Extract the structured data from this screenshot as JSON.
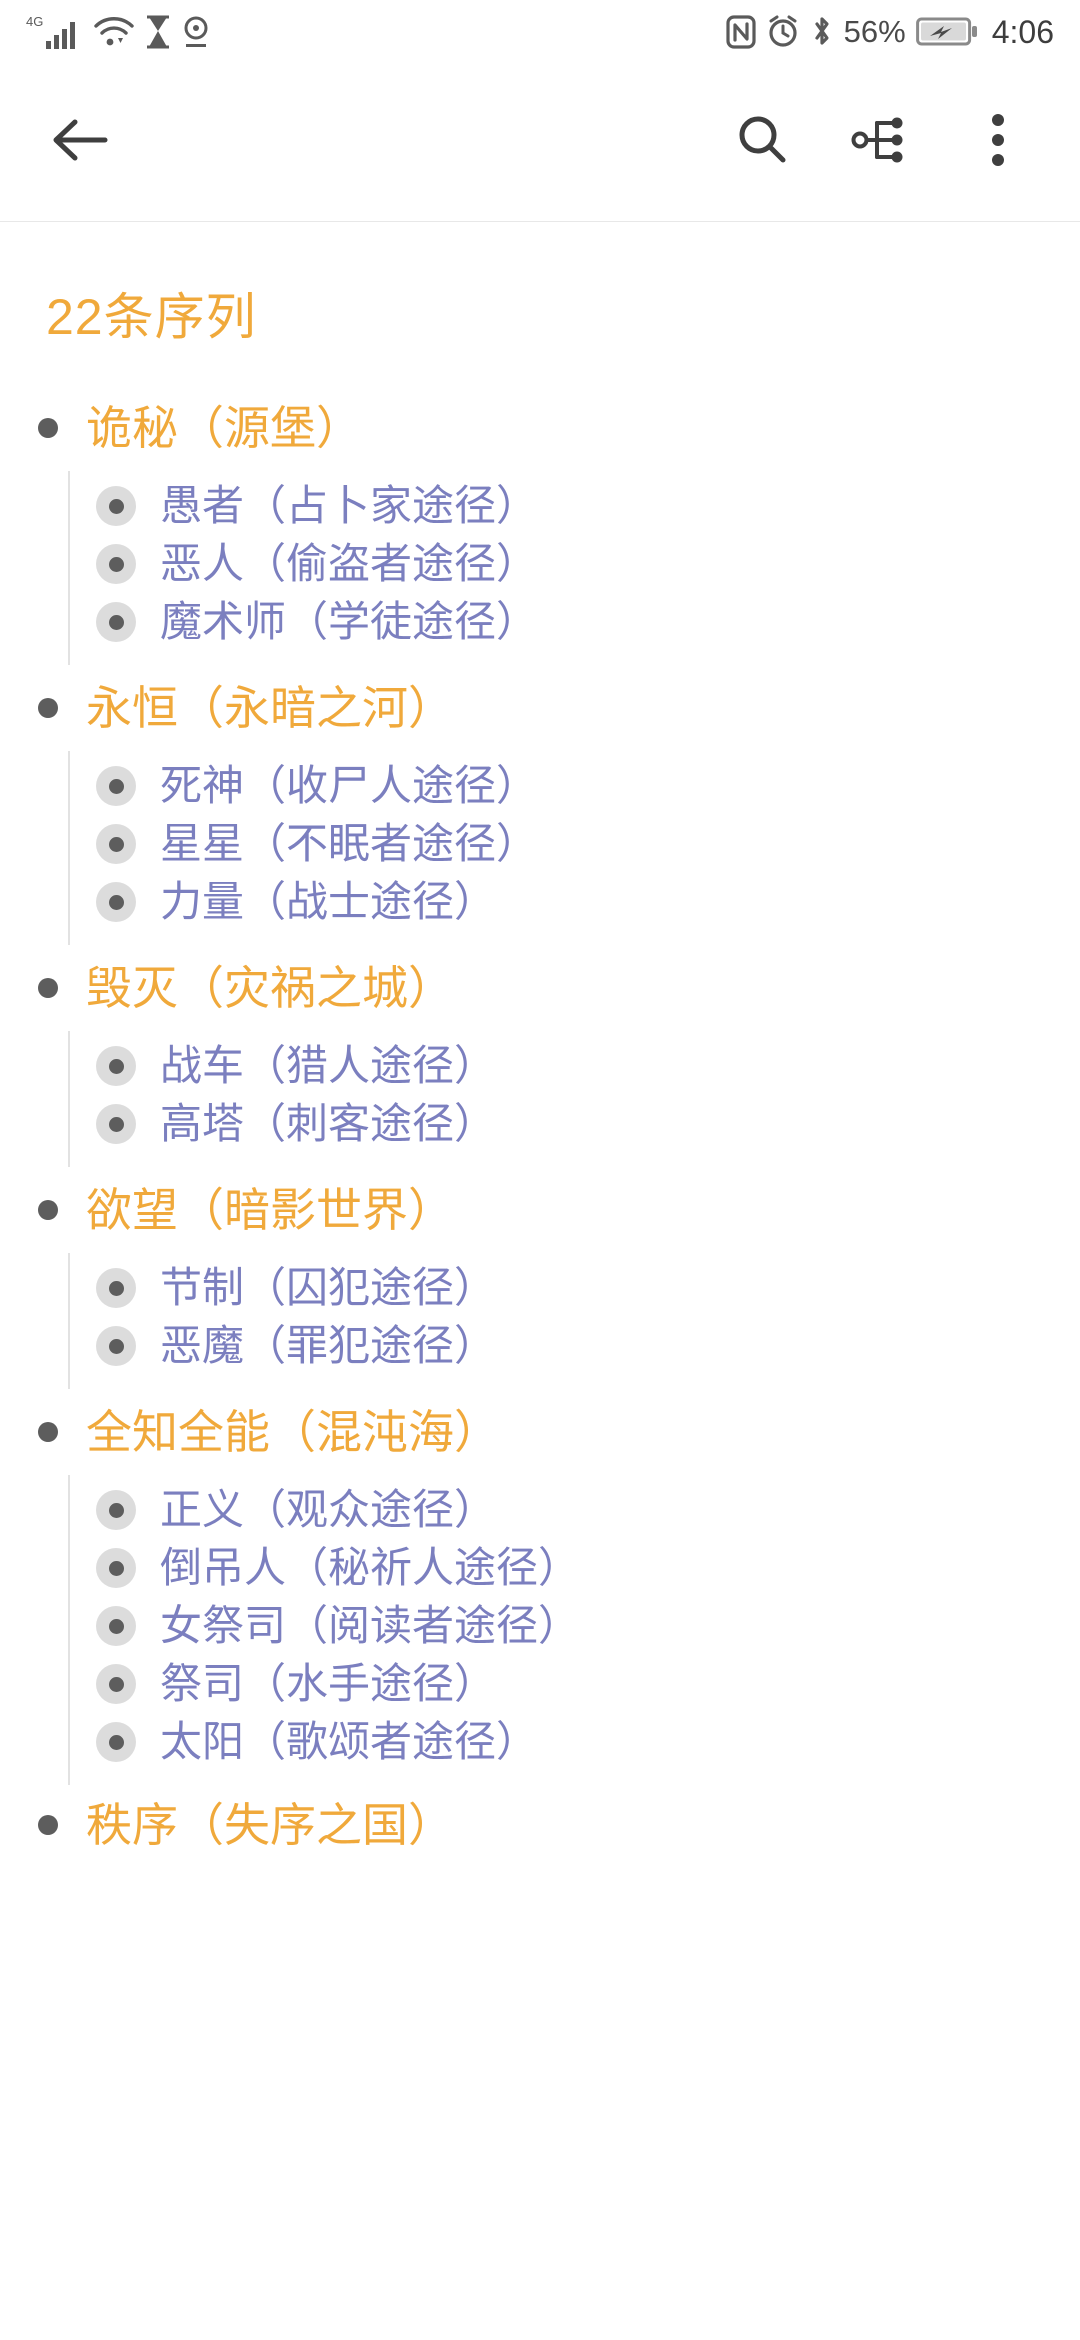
{
  "statusbar": {
    "network_type": "4G",
    "left_icons": [
      "signal-bars-icon",
      "wifi-icon",
      "hourglass-icon",
      "location-pin-icon"
    ],
    "right_icons": [
      "nfc-icon",
      "alarm-clock-icon",
      "bluetooth-icon"
    ],
    "battery_percent": "56%",
    "battery_state": "charging",
    "clock": "4:06"
  },
  "toolbar": {
    "back": "back-arrow-icon",
    "search": "search-icon",
    "outline": "mindmap-outline-icon",
    "overflow": "more-vertical-icon"
  },
  "page": {
    "title": "22条序列"
  },
  "colors": {
    "accent_orange": "#f0a93b",
    "item_purple": "#7b7fbf",
    "bullet_gray": "#5d5d5d",
    "marker_bg": "#dcdcdc",
    "guide_line": "#e2e2e2"
  },
  "outline": {
    "groups": [
      {
        "label": "诡秘（源堡）",
        "items": [
          {
            "label": "愚者（占卜家途径）"
          },
          {
            "label": "恶人（偷盗者途径）"
          },
          {
            "label": "魔术师（学徒途径）"
          }
        ]
      },
      {
        "label": "永恒（永暗之河）",
        "items": [
          {
            "label": "死神（收尸人途径）"
          },
          {
            "label": "星星（不眠者途径）"
          },
          {
            "label": "力量（战士途径）"
          }
        ]
      },
      {
        "label": "毁灭（灾祸之城）",
        "items": [
          {
            "label": "战车（猎人途径）"
          },
          {
            "label": "高塔（刺客途径）"
          }
        ]
      },
      {
        "label": "欲望（暗影世界）",
        "items": [
          {
            "label": "节制（囚犯途径）"
          },
          {
            "label": "恶魔（罪犯途径）"
          }
        ]
      },
      {
        "label": "全知全能（混沌海）",
        "items": [
          {
            "label": "正义（观众途径）"
          },
          {
            "label": "倒吊人（秘祈人途径）"
          },
          {
            "label": "女祭司（阅读者途径）"
          },
          {
            "label": "祭司（水手途径）"
          },
          {
            "label": "太阳（歌颂者途径）"
          }
        ]
      },
      {
        "label": "秩序（失序之国）",
        "items": []
      }
    ]
  }
}
